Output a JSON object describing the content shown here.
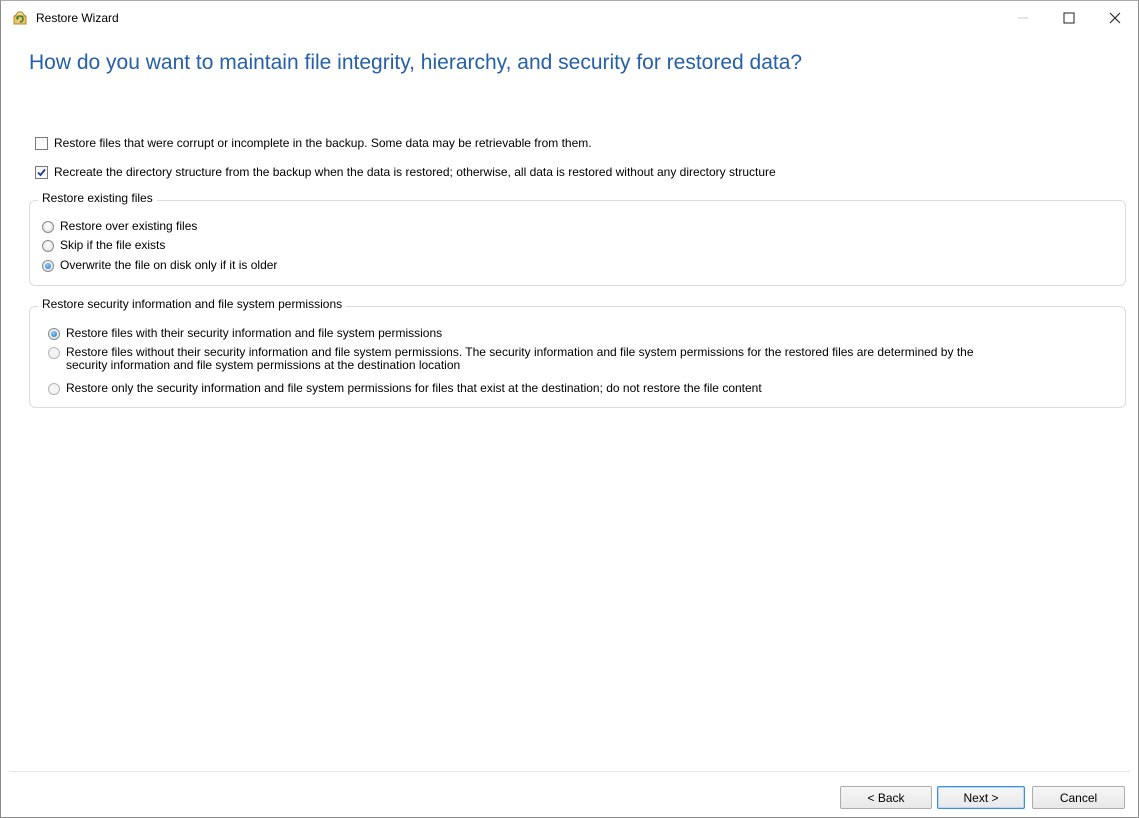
{
  "window": {
    "title": "Restore Wizard",
    "minimize_glyph": "—",
    "maximize_glyph": "☐",
    "close_glyph": "✕",
    "icon": "restore-wizard-icon"
  },
  "page": {
    "heading": "How do you want to maintain file integrity, hierarchy, and security for restored data?"
  },
  "options": {
    "corrupt": {
      "label": "Restore files that were corrupt or incomplete in the backup. Some data may be retrievable from them.",
      "checked": false
    },
    "directory": {
      "label": "Recreate the directory structure from the backup when the data is restored; otherwise, all data is restored without any directory structure",
      "checked": true
    }
  },
  "existing_group": {
    "legend": "Restore existing files",
    "options": [
      {
        "label": "Restore over existing files",
        "selected": false
      },
      {
        "label": "Skip if the file exists",
        "selected": false
      },
      {
        "label": "Overwrite the file on disk only if it is older",
        "selected": true
      }
    ]
  },
  "security_group": {
    "legend": "Restore security information and file system permissions",
    "options": [
      {
        "label": "Restore files with their security information and file system permissions",
        "selected": true
      },
      {
        "label": "Restore files without their security information and file system permissions. The security information and file system permissions for the restored files are determined by the",
        "label_line2": "security information and file system permissions at the destination location",
        "selected": false
      },
      {
        "label": "Restore only the security information and file system permissions for files that exist at the destination; do not restore the file content",
        "selected": false
      }
    ]
  },
  "buttons": {
    "back": "< Back",
    "next": "Next >",
    "cancel": "Cancel"
  },
  "colors": {
    "heading": "#2560a8",
    "accent": "#1a66c9"
  }
}
